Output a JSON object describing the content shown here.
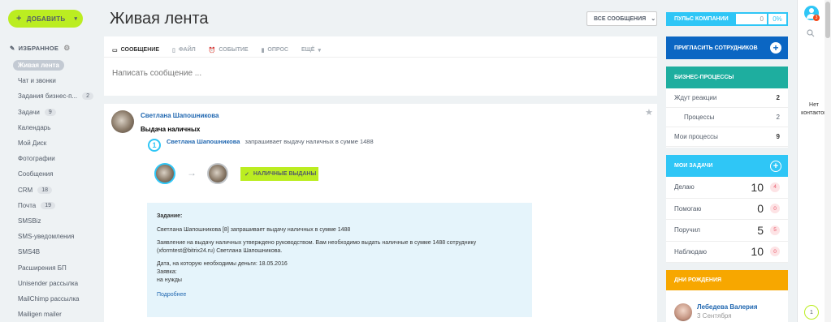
{
  "sidebar": {
    "add_button": "ДОБАВИТЬ",
    "favorites_label": "ИЗБРАННОЕ",
    "items": [
      {
        "label": "Живая лента",
        "active": true
      },
      {
        "label": "Чат и звонки"
      },
      {
        "label": "Задания бизнес-п...",
        "count": "2"
      },
      {
        "label": "Задачи",
        "count": "9"
      },
      {
        "label": "Календарь"
      },
      {
        "label": "Мой Диск"
      },
      {
        "label": "Фотографии"
      },
      {
        "label": "Сообщения"
      },
      {
        "label": "CRM",
        "count": "18"
      },
      {
        "label": "Почта",
        "count": "19"
      },
      {
        "label": "SMSBiz"
      },
      {
        "label": "SMS-уведомления"
      },
      {
        "label": "SMS4B"
      },
      {
        "label": "Расширения БП"
      },
      {
        "label": "Unisender рассылка"
      },
      {
        "label": "MailChimp рассылка"
      },
      {
        "label": "Mailigen mailer"
      }
    ]
  },
  "header": {
    "title": "Живая лента",
    "filter": "ВСЕ СООБЩЕНИЯ"
  },
  "post_form": {
    "tabs": [
      {
        "icon": "message-icon",
        "label": "СООБЩЕНИЕ",
        "active": true
      },
      {
        "icon": "file-icon",
        "label": "ФАЙЛ"
      },
      {
        "icon": "event-icon",
        "label": "СОБЫТИЕ"
      },
      {
        "icon": "poll-icon",
        "label": "ОПРОС"
      },
      {
        "icon": "chevron-down-icon",
        "label": "ЕЩЁ"
      }
    ],
    "placeholder": "Написать сообщение ..."
  },
  "post": {
    "author": "Светлана Шапошникова",
    "title": "Выдача наличных",
    "bp_step": "1",
    "bp_author": "Светлана Шапошникова",
    "bp_text": "запрашивает выдачу наличных в сумме 1488",
    "status_badge": "НАЛИЧНЫЕ ВЫДАНЫ",
    "task": {
      "heading": "Задание:",
      "line1": "Светлана Шапошникова [8] запрашивает выдачу наличных в сумме 1488",
      "line2": "Заявление на выдачу наличных утверждено руководством. Вам необходимо выдать наличные в сумме 1488 сотруднику (xformtest@bitrix24.ru) Светлана Шапошникова.",
      "line3": "Дата, на которую необходимы деньги: 18.05.2016",
      "line4": "Заявка:",
      "line5": "на нужды",
      "more": "Подробнее"
    }
  },
  "right": {
    "pulse": {
      "label": "ПУЛЬС КОМПАНИИ",
      "value": "0",
      "percent": "0%"
    },
    "invite": "ПРИГЛАСИТЬ СОТРУДНИКОВ",
    "bp_widget": {
      "title": "БИЗНЕС-ПРОЦЕССЫ",
      "rows": [
        {
          "label": "Ждут реакции",
          "value": "2"
        },
        {
          "label": "Процессы",
          "value": "2"
        },
        {
          "label": "Мои процессы",
          "value": "9"
        }
      ]
    },
    "tasks_widget": {
      "title": "МОИ ЗАДАЧИ",
      "rows": [
        {
          "label": "Делаю",
          "value": "10",
          "badge": "4"
        },
        {
          "label": "Помогаю",
          "value": "0",
          "badge": "0"
        },
        {
          "label": "Поручил",
          "value": "5",
          "badge": "5"
        },
        {
          "label": "Наблюдаю",
          "value": "10",
          "badge": "0"
        }
      ]
    },
    "birthdays": {
      "title": "ДНИ РОЖДЕНИЯ",
      "name": "Лебедева Валерия",
      "date": "3 Сентября"
    }
  },
  "chat_panel": {
    "notif_count": "3",
    "no_contacts": "Нет контактов",
    "counter": "1"
  },
  "colors": {
    "accent_green": "#bbed21",
    "accent_blue": "#2fc6f6",
    "brand_blue": "#0b66c3",
    "teal": "#1eae9f",
    "orange": "#f7a700"
  }
}
